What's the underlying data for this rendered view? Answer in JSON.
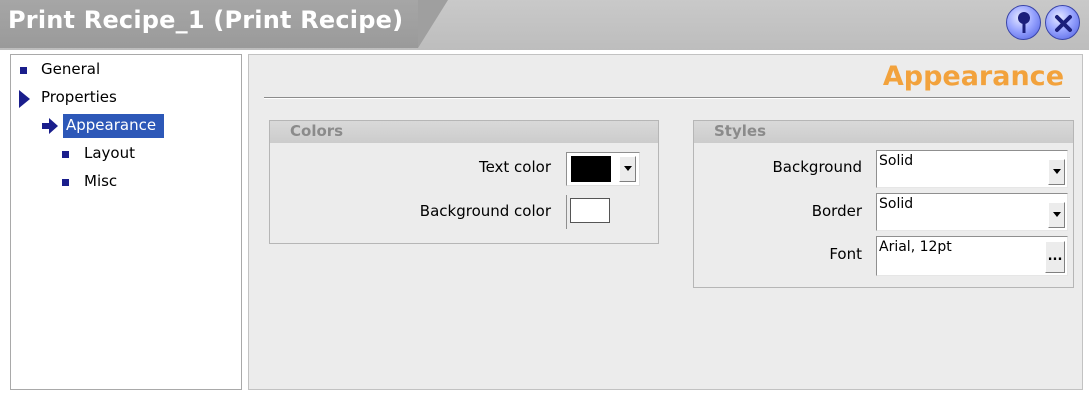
{
  "window": {
    "title": "Print Recipe_1 (Print Recipe)",
    "pin_icon": "pin-icon",
    "close_icon": "close-icon",
    "accent_color": "#f2a23c",
    "selection_color": "#2d58b8"
  },
  "tree": {
    "items": [
      {
        "label": "General",
        "icon": "bullet-icon"
      },
      {
        "label": "Properties",
        "icon": "expanded-triangle-icon"
      },
      {
        "label": "Appearance",
        "icon": "arrow-right-icon",
        "selected": true
      },
      {
        "label": "Layout",
        "icon": "bullet-icon"
      },
      {
        "label": "Misc",
        "icon": "bullet-icon"
      }
    ]
  },
  "main": {
    "heading": "Appearance",
    "colors_group": {
      "title": "Colors",
      "text_color_label": "Text color",
      "text_color_value": "#000000",
      "background_color_label": "Background color",
      "background_color_value": "#ffffff"
    },
    "styles_group": {
      "title": "Styles",
      "background_label": "Background",
      "background_value": "Solid",
      "border_label": "Border",
      "border_value": "Solid",
      "font_label": "Font",
      "font_value": "Arial, 12pt",
      "font_button": "..."
    }
  }
}
